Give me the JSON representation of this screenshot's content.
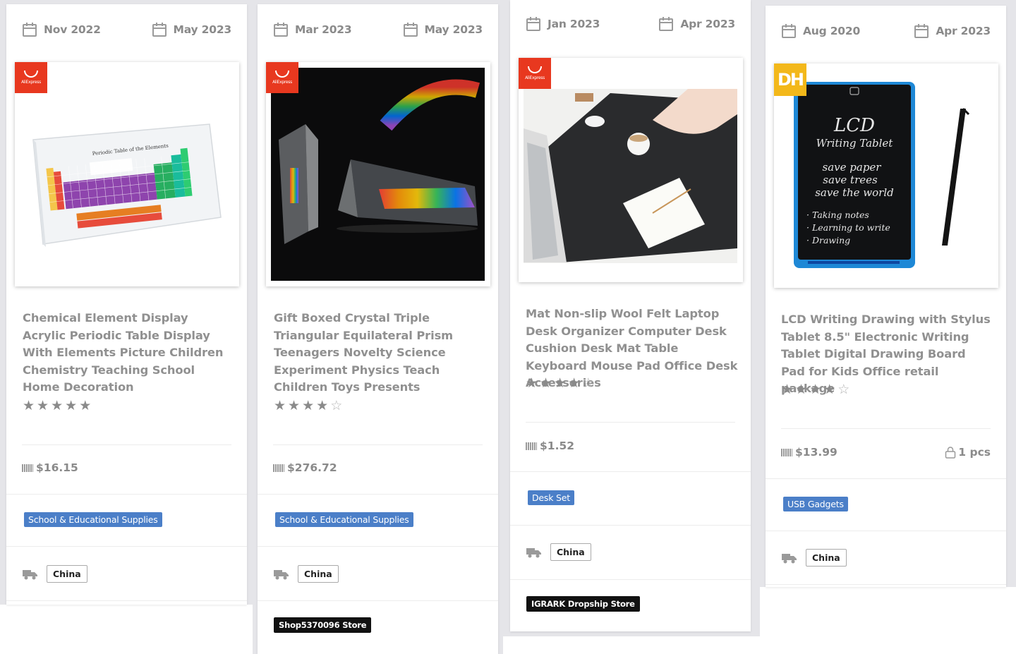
{
  "cards": [
    {
      "start_date": "Nov 2022",
      "end_date": "May 2023",
      "source": "AliExpress",
      "title": "Chemical Element Display Acrylic Periodic Table Display With Elements Picture Children Chemistry Teaching School Home Decoration",
      "rating": 5,
      "price": "$16.15",
      "category": "School & Educational Supplies",
      "ship_from": "China",
      "store": ""
    },
    {
      "start_date": "Mar 2023",
      "end_date": "May 2023",
      "source": "AliExpress",
      "title": "Gift Boxed Crystal Triple Triangular Equilateral Prism Teenagers Novelty Science Experiment Physics Teach Children Toys Presents",
      "rating": 4,
      "price": "$276.72",
      "category": "School & Educational Supplies",
      "ship_from": "China",
      "store": "Shop5370096 Store"
    },
    {
      "start_date": "Jan 2023",
      "end_date": "Apr 2023",
      "source": "AliExpress",
      "title": "Mat Non-slip Wool Felt Laptop Desk Organizer Computer Desk Cushion Desk Mat Table Keyboard Mouse Pad Office Desk Accessories",
      "rating": 4,
      "price": "$1.52",
      "category": "Desk Set",
      "ship_from": "China",
      "store": "IGRARK Dropship Store"
    },
    {
      "start_date": "Aug 2020",
      "end_date": "Apr 2023",
      "source": "DH",
      "title": "LCD Writing Drawing with Stylus Tablet 8.5\" Electronic Writing Tablet Digital Drawing Board Pad for Kids Office retail package",
      "rating": 4,
      "price": "$13.99",
      "quantity": "1 pcs",
      "category": "USB Gadgets",
      "ship_from": "China",
      "store": ""
    }
  ],
  "badge_text": {
    "aliexpress": "AliExpress",
    "dh": "DH"
  },
  "image_text": {
    "periodic": "Periodic Table of the Elements",
    "lcd_title": "LCD",
    "lcd_sub": "Writing Tablet",
    "lcd_line1": "save paper",
    "lcd_line2": "save trees",
    "lcd_line3": "save the world",
    "lcd_b1": "· Taking notes",
    "lcd_b2": "· Learning to write",
    "lcd_b3": "· Drawing"
  },
  "colors": {
    "tag_blue": "#4b7fc8",
    "aliexpress_red": "#e8381f",
    "dh_yellow": "#f3b81a",
    "store_black": "#111111"
  },
  "icons": {
    "date": "calendar-icon",
    "price": "barcode-icon",
    "quantity": "lock-icon",
    "shipping": "truck-icon",
    "rating": "star-icon"
  }
}
